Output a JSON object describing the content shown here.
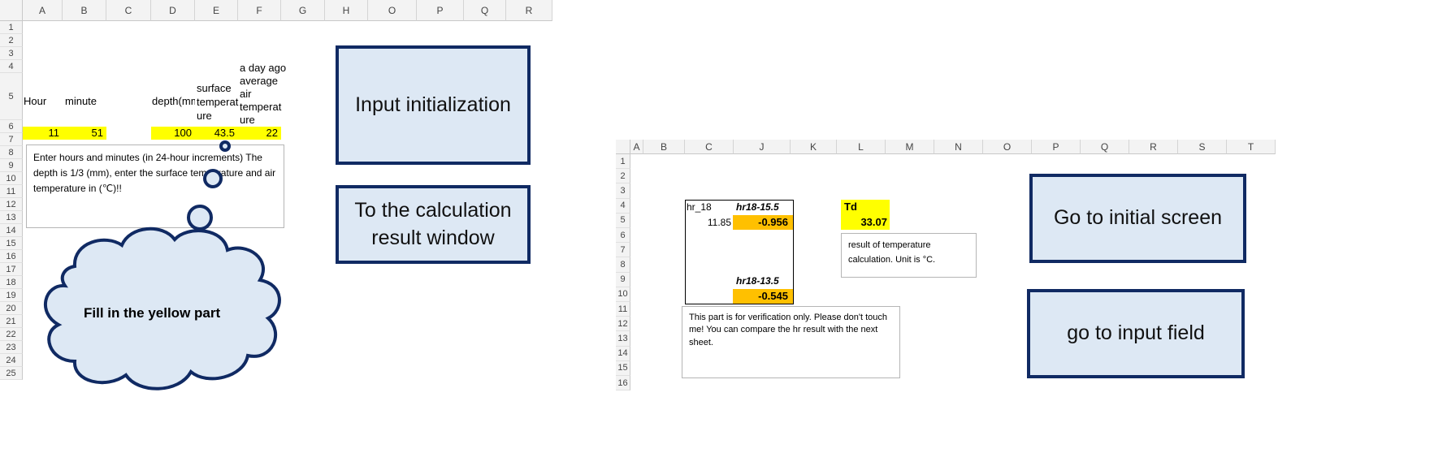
{
  "left_sheet": {
    "columns": [
      "A",
      "B",
      "C",
      "D",
      "E",
      "F",
      "G",
      "H",
      "O",
      "P",
      "Q",
      "R"
    ],
    "rows": [
      "1",
      "2",
      "3",
      "4",
      "5",
      "6",
      "7",
      "8",
      "9",
      "10",
      "11",
      "12",
      "13",
      "14",
      "15",
      "16",
      "17",
      "18",
      "19",
      "20",
      "21",
      "22",
      "23",
      "24",
      "25"
    ],
    "headers": {
      "hour": "Hour",
      "minute": "minute",
      "depth": "depth(mm",
      "surface_temp": [
        "surface",
        "temperat",
        "ure"
      ],
      "air_temp": [
        "a day ago",
        "average",
        "air",
        "temperat",
        "ure"
      ]
    },
    "values": {
      "hour": "11",
      "minute": "51",
      "depth": "100",
      "surface_temp": "43.5",
      "air_temp": "22"
    },
    "note": "Enter hours and minutes (in 24-hour increments) The depth is 1/3 (mm), enter the surface temperature and air temperature in (℃)!!",
    "cloud_text": "Fill in the yellow part",
    "buttons": {
      "init": "Input initialization",
      "to_result": [
        "To the calculation",
        "result window"
      ]
    }
  },
  "right_sheet": {
    "columns": [
      "A",
      "B",
      "C",
      "J",
      "K",
      "L",
      "M",
      "N",
      "O",
      "P",
      "Q",
      "R",
      "S",
      "T"
    ],
    "rows": [
      "1",
      "2",
      "3",
      "4",
      "5",
      "6",
      "7",
      "8",
      "9",
      "10",
      "11",
      "12",
      "13",
      "14",
      "15",
      "16"
    ],
    "hr_label": "hr_18",
    "hr_value": "11.85",
    "hr155_label": "hr18-15.5",
    "hr155_value": "-0.956",
    "hr135_label": "hr18-13.5",
    "hr135_value": "-0.545",
    "td_label": "Td",
    "td_value": "33.07",
    "td_note": "result of temperature calculation. Unit is °C.",
    "verify_note": "This part is for verification only. Please don't touch me! You can compare the hr result with the next sheet.",
    "buttons": {
      "initial": "Go to initial screen",
      "input": "go to input field"
    }
  }
}
